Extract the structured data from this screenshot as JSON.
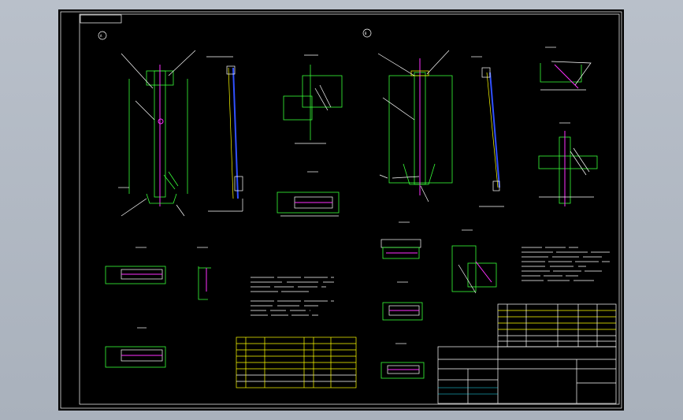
{
  "drawing": {
    "project_label": "",
    "view_a_label": "A",
    "view_b_label": "B",
    "roughness_label": "",
    "notes_title_1": "",
    "notes_title_2": "",
    "title_block_name": "",
    "drawing_number": ""
  },
  "colors": {
    "viewport_bg": "#b5bcc6",
    "sheet_bg": "#000000",
    "frame": "#ffffff",
    "outline": "#38ff38",
    "dimension": "#ffffff",
    "table": "#ffff00",
    "centerline": "#ff30ff",
    "section": "#3050ff"
  },
  "icons": {
    "view_marker": "circle-letter-icon",
    "roughness": "check-mark-icon"
  }
}
